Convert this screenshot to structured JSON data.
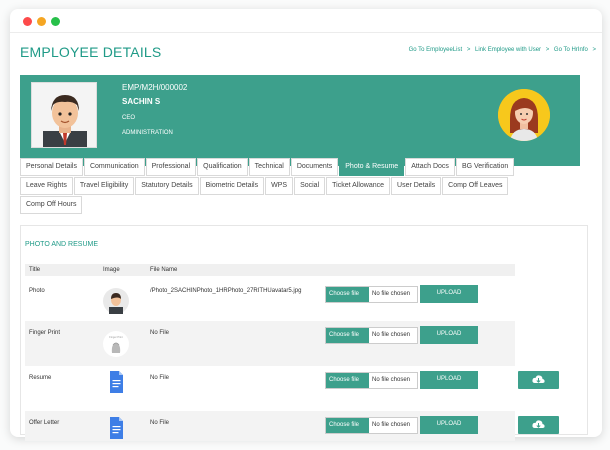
{
  "page": {
    "title": "EMPLOYEE DETAILS",
    "links": [
      "Go To EmployeeList",
      ">",
      "Link Employee with User",
      ">",
      "Go To HrInfo",
      ">"
    ]
  },
  "employee": {
    "code": "EMP/M2H/000002",
    "name": "SACHIN S",
    "role": "CEO",
    "department": "ADMINISTRATION"
  },
  "tabs": {
    "row1": [
      "Personal Details",
      "Communication",
      "Professional",
      "Qualification",
      "Technical",
      "Documents",
      "Photo & Resume",
      "Attach Docs",
      "BG Verification"
    ],
    "row2": [
      "Leave Rights",
      "Travel Eligibility",
      "Statutory Details",
      "Biometric Details",
      "WPS",
      "Social",
      "Ticket Allowance",
      "User Details",
      "Comp Off Leaves"
    ],
    "row3": [
      "Comp Off Hours"
    ],
    "active": "Photo & Resume"
  },
  "panel": {
    "title": "PHOTO AND RESUME",
    "columns": [
      "Title",
      "Image",
      "File Name"
    ],
    "rows": [
      {
        "title": "Photo",
        "file": "/Photo_2SACHINPhoto_1HRPhoto_27RITHUavatar5.jpg",
        "image": "avatar",
        "has_download": false
      },
      {
        "title": "Finger Print",
        "file": "No File",
        "image": "fingerprint",
        "has_download": false
      },
      {
        "title": "Resume",
        "file": "No File",
        "image": "document",
        "has_download": true
      },
      {
        "title": "Offer Letter",
        "file": "No File",
        "image": "document",
        "has_download": true
      }
    ],
    "choose_label": "Choose file",
    "no_file_label": "No file chosen",
    "upload_label": "UPLOAD",
    "thumb_caption": "Finger Print"
  }
}
